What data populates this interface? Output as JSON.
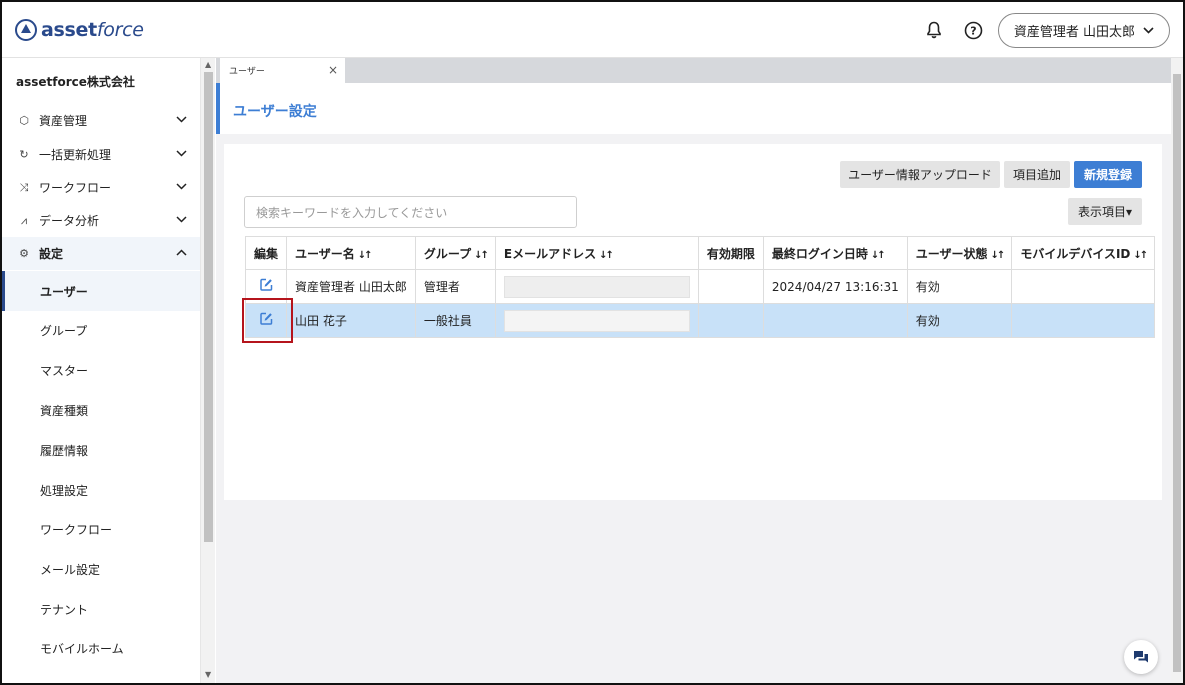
{
  "header": {
    "logo_bold": "asset",
    "logo_italic": "force",
    "bell_icon": "bell-icon",
    "help_icon": "help-circle-icon",
    "user_name": "資産管理者 山田太郎",
    "user_chevron": "⌄"
  },
  "sidebar": {
    "company": "assetforce株式会社",
    "groups": [
      {
        "icon": "cube-icon",
        "label": "資産管理",
        "chevron": "⌄"
      },
      {
        "icon": "refresh-icon",
        "label": "一括更新処理",
        "chevron": "⌄"
      },
      {
        "icon": "workflow-icon",
        "label": "ワークフロー",
        "chevron": "⌄"
      },
      {
        "icon": "chart-icon",
        "label": "データ分析",
        "chevron": "⌄"
      },
      {
        "icon": "gear-icon",
        "label": "設定",
        "chevron": "⌃"
      }
    ],
    "sub_items": [
      {
        "label": "ユーザー"
      },
      {
        "label": "グループ"
      },
      {
        "label": "マスター"
      },
      {
        "label": "資産種類"
      },
      {
        "label": "履歴情報"
      },
      {
        "label": "処理設定"
      },
      {
        "label": "ワークフロー"
      },
      {
        "label": "メール設定"
      },
      {
        "label": "テナント"
      },
      {
        "label": "モバイルホーム"
      }
    ]
  },
  "tab": {
    "label": "ユーザー",
    "close": "×"
  },
  "page": {
    "title": "ユーザー設定"
  },
  "toolbar": {
    "upload_label": "ユーザー情報アップロード",
    "add_field_label": "項目追加",
    "new_label": "新規登録",
    "display_label": "表示項目▾"
  },
  "search": {
    "placeholder": "検索キーワードを入力してください"
  },
  "table": {
    "columns": [
      "編集",
      "ユーザー名",
      "グループ",
      "Eメールアドレス",
      "有効期限",
      "最終ログイン日時",
      "ユーザー状態",
      "モバイルデバイスID"
    ],
    "sort_marker": "↓↑",
    "rows": [
      {
        "name": "資産管理者 山田太郎",
        "group": "管理者",
        "expiry": "",
        "last_login": "2024/04/27 13:16:31",
        "status": "有効",
        "device_id": ""
      },
      {
        "name": "山田 花子",
        "group": "一般社員",
        "expiry": "",
        "last_login": "",
        "status": "有効",
        "device_id": ""
      }
    ]
  },
  "chat": {
    "icon": "chat-icon"
  }
}
